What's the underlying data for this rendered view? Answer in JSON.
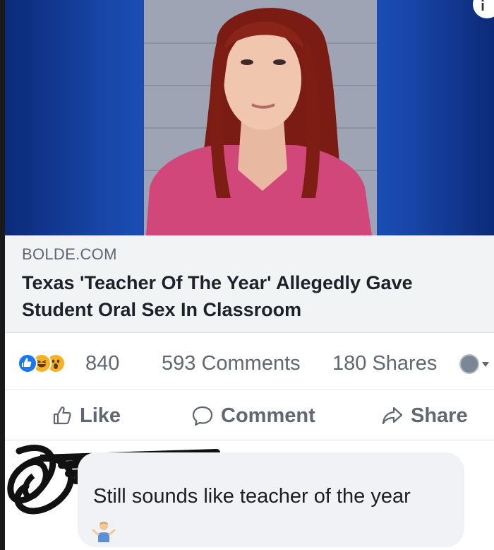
{
  "link_preview": {
    "domain": "BOLDE.COM",
    "title": "Texas 'Teacher Of The Year' Allegedly Gave Student Oral Sex In Classroom"
  },
  "stats": {
    "reactions_count": "840",
    "reaction_icons": [
      "like-icon",
      "haha-icon",
      "wow-icon"
    ],
    "comments": "593 Comments",
    "shares": "180 Shares"
  },
  "actions": {
    "like_label": "Like",
    "comment_label": "Comment",
    "share_label": "Share"
  },
  "comment": {
    "text": "Still sounds like teacher of the year",
    "emoji": "person-shrugging-icon"
  },
  "colors": {
    "image_background": "#10348a",
    "link_box_background": "#f2f3f5",
    "like_blue": "#1877f2",
    "secondary_text": "#606770",
    "comment_bubble": "#f0f2f5"
  }
}
